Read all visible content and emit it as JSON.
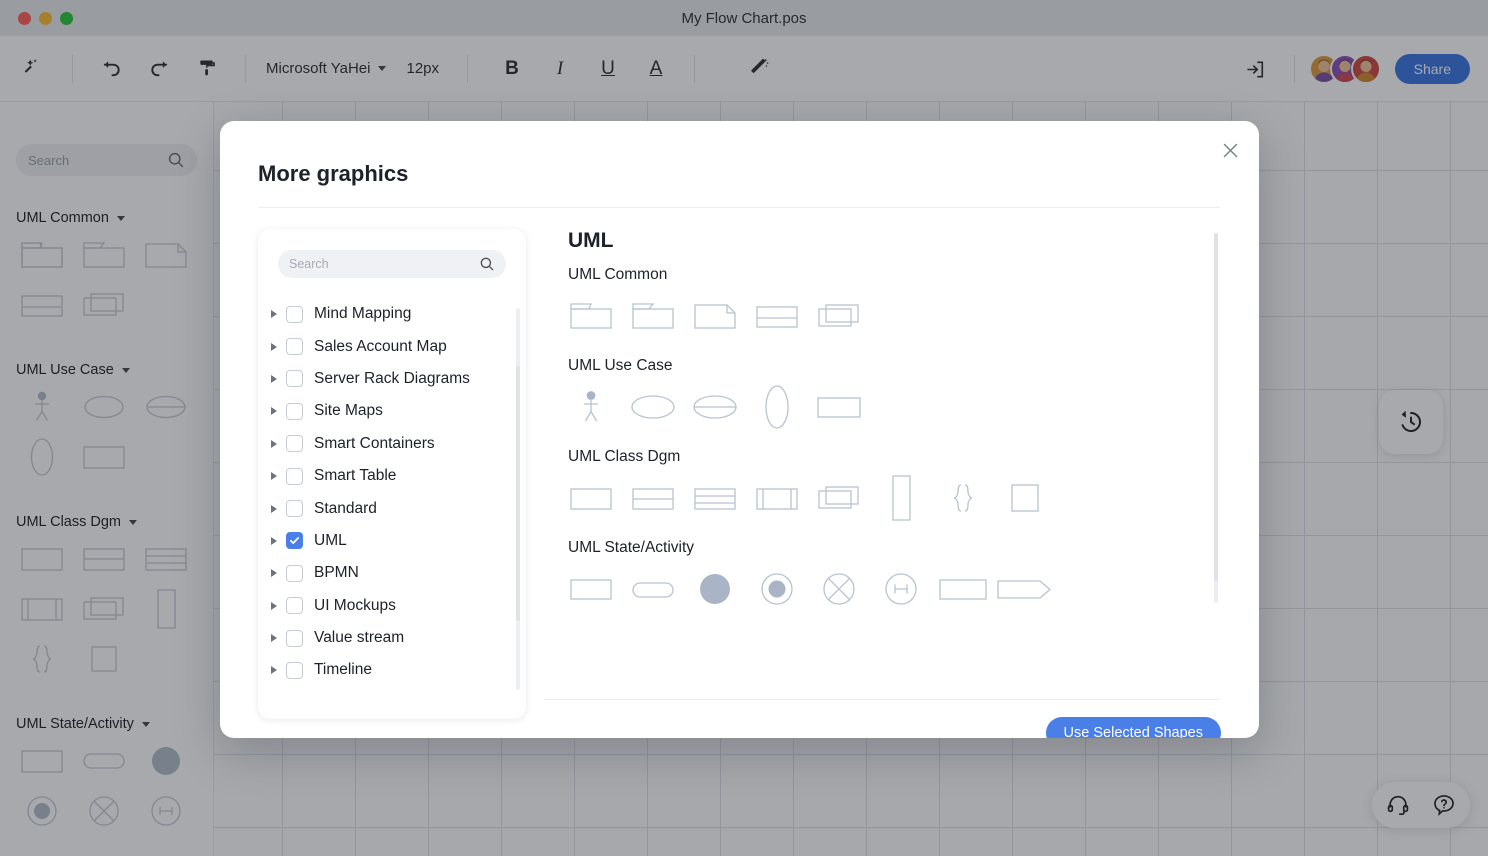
{
  "window": {
    "title": "My Flow Chart.pos",
    "traffic_lights": [
      "close",
      "minimize",
      "maximize"
    ]
  },
  "toolbar": {
    "magic_add_icon": "magic-wand-plus-icon",
    "undo_icon": "undo-icon",
    "redo_icon": "redo-icon",
    "format_painter_icon": "paint-roller-icon",
    "font_family": "Microsoft  YaHei",
    "font_size": "12px",
    "bold_label": "B",
    "italic_label": "I",
    "underline_label": "U",
    "font_color_label": "A",
    "style_wand_icon": "style-wand-icon",
    "import_icon": "import-arrow-icon",
    "share_label": "Share",
    "avatars": [
      {
        "name": "collaborator-1",
        "bg": "#e09a3e",
        "hair": "#241f25",
        "body": "#7c4fa8"
      },
      {
        "name": "collaborator-2",
        "bg": "#8b4fb5",
        "hair": "#2a2430",
        "body": "#d04a56"
      },
      {
        "name": "collaborator-3",
        "bg": "#d0483f",
        "hair": "#2b2026",
        "body": "#d4892e"
      }
    ]
  },
  "sidebar": {
    "search_placeholder": "Search",
    "groups": [
      {
        "title": "UML Common",
        "shapes": [
          "package-tab",
          "package-angled-tab",
          "note-folded",
          "frame-split",
          "stacked-rects"
        ]
      },
      {
        "title": "UML Use Case",
        "shapes": [
          "actor",
          "ellipse",
          "ellipse-divided",
          "ellipse-vertical",
          "rectangle"
        ]
      },
      {
        "title": "UML Class Dgm",
        "shapes": [
          "rectangle",
          "class-2-compartment",
          "class-3-compartment",
          "rect-vertical-split",
          "stacked-rects",
          "tall-rectangle",
          "braces",
          "square"
        ]
      },
      {
        "title": "UML State/Activity",
        "shapes": [
          "rectangle",
          "rounded-rect",
          "filled-circle",
          "circle-in-circle",
          "circle-x",
          "circle-h"
        ]
      }
    ]
  },
  "canvas": {
    "history_icon": "history-rewind-icon",
    "support_icon": "headset-icon",
    "help_icon": "question-bubble-icon"
  },
  "modal": {
    "title": "More graphics",
    "close_icon": "close-icon",
    "search_placeholder": "Search",
    "categories": [
      {
        "label": "Mind Mapping",
        "checked": false
      },
      {
        "label": "Sales Account Map",
        "checked": false
      },
      {
        "label": "Server Rack Diagrams",
        "checked": false
      },
      {
        "label": "Site Maps",
        "checked": false
      },
      {
        "label": "Smart Containers",
        "checked": false
      },
      {
        "label": "Smart Table",
        "checked": false
      },
      {
        "label": "Standard",
        "checked": false
      },
      {
        "label": "UML",
        "checked": true
      },
      {
        "label": "BPMN",
        "checked": false
      },
      {
        "label": "UI Mockups",
        "checked": false
      },
      {
        "label": "Value stream",
        "checked": false
      },
      {
        "label": "Timeline",
        "checked": false
      }
    ],
    "preview": {
      "title": "UML",
      "sections": [
        {
          "title": "UML Common",
          "shapes": [
            "package-tab",
            "package-angled-tab",
            "note-folded",
            "frame-split",
            "stacked-rects"
          ]
        },
        {
          "title": "UML Use Case",
          "shapes": [
            "actor",
            "ellipse",
            "ellipse-divided",
            "ellipse-vertical",
            "rectangle"
          ]
        },
        {
          "title": "UML Class Dgm",
          "shapes": [
            "rectangle",
            "class-2-compartment",
            "class-3-compartment",
            "rect-vertical-split",
            "stacked-rects",
            "tall-rectangle",
            "braces",
            "square"
          ]
        },
        {
          "title": "UML State/Activity",
          "shapes": [
            "rectangle",
            "rounded-rect",
            "filled-circle",
            "circle-in-circle",
            "circle-x",
            "circle-h",
            "rectangle",
            "arrow-pentagon"
          ]
        }
      ]
    },
    "confirm_label": "Use Selected Shapes"
  },
  "colors": {
    "accent": "#4a7fe8",
    "share": "#3b77e3",
    "shape_stroke": "#b9c2d0",
    "shape_fill": "#a9b4c6"
  }
}
